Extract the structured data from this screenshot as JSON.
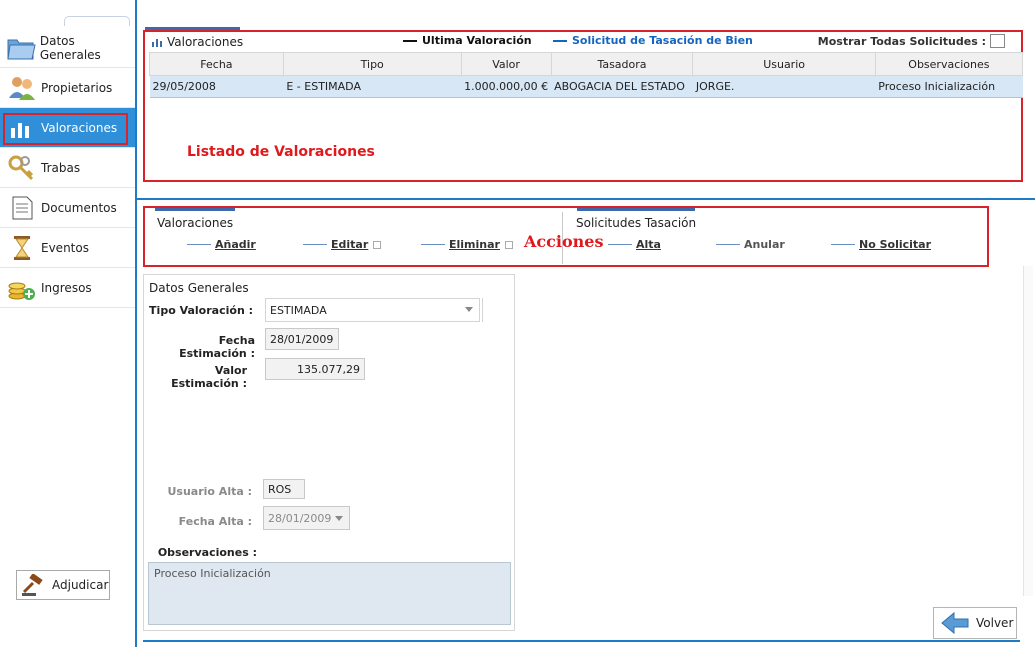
{
  "sidebar": {
    "items": [
      {
        "label": "Datos Generales",
        "icon": "folder-icon"
      },
      {
        "label": "Propietarios",
        "icon": "users-icon"
      },
      {
        "label": "Valoraciones",
        "icon": "bar-chart-icon"
      },
      {
        "label": "Trabas",
        "icon": "keys-icon"
      },
      {
        "label": "Documentos",
        "icon": "document-icon"
      },
      {
        "label": "Eventos",
        "icon": "hourglass-icon"
      },
      {
        "label": "Ingresos",
        "icon": "coins-icon"
      }
    ],
    "active_index": 2,
    "adjudicar_label": "Adjudicar"
  },
  "grid": {
    "title": "Valoraciones",
    "legend_last": "Ultima Valoración",
    "legend_request": "Solicitud de Tasación de Bien",
    "show_all_label": "Mostrar Todas Solicitudes :",
    "columns": [
      "Fecha",
      "Tipo",
      "Valor",
      "Tasadora",
      "Usuario",
      "Observaciones"
    ],
    "rows": [
      [
        "29/05/2008",
        "E - ESTIMADA",
        "1.000.000,00 €",
        "ABOGACIA DEL ESTADO",
        "JORGE.",
        "Proceso Inicialización"
      ]
    ]
  },
  "annotations": {
    "listado": "Listado de Valoraciones",
    "acciones": "Acciones"
  },
  "actions": {
    "valoraciones_title": "Valoraciones",
    "add": "Añadir",
    "edit": "Editar",
    "delete": "Eliminar",
    "solicitudes_title": "Solicitudes Tasación",
    "alta": "Alta",
    "anular": "Anular",
    "no_solicitar": "No Solicitar"
  },
  "form": {
    "section_title": "Datos Generales",
    "tipo_label": "Tipo Valoración :",
    "tipo_value": "ESTIMADA",
    "fecha_label": "Fecha Estimación :",
    "fecha_value": "28/01/2009",
    "valor_label": "Valor Estimación :",
    "valor_value": "135.077,29",
    "usuario_alta_label": "Usuario Alta :",
    "usuario_alta_value": "ROS",
    "fecha_alta_label": "Fecha Alta :",
    "fecha_alta_value": "28/01/2009",
    "observaciones_label": "Observaciones :",
    "observaciones_value": "Proceso Inicialización"
  },
  "footer": {
    "volver_label": "Volver"
  },
  "colors": {
    "accent_blue": "#2f8fd8",
    "highlight_red": "#d9232a",
    "legend_blue": "#1565c0"
  }
}
